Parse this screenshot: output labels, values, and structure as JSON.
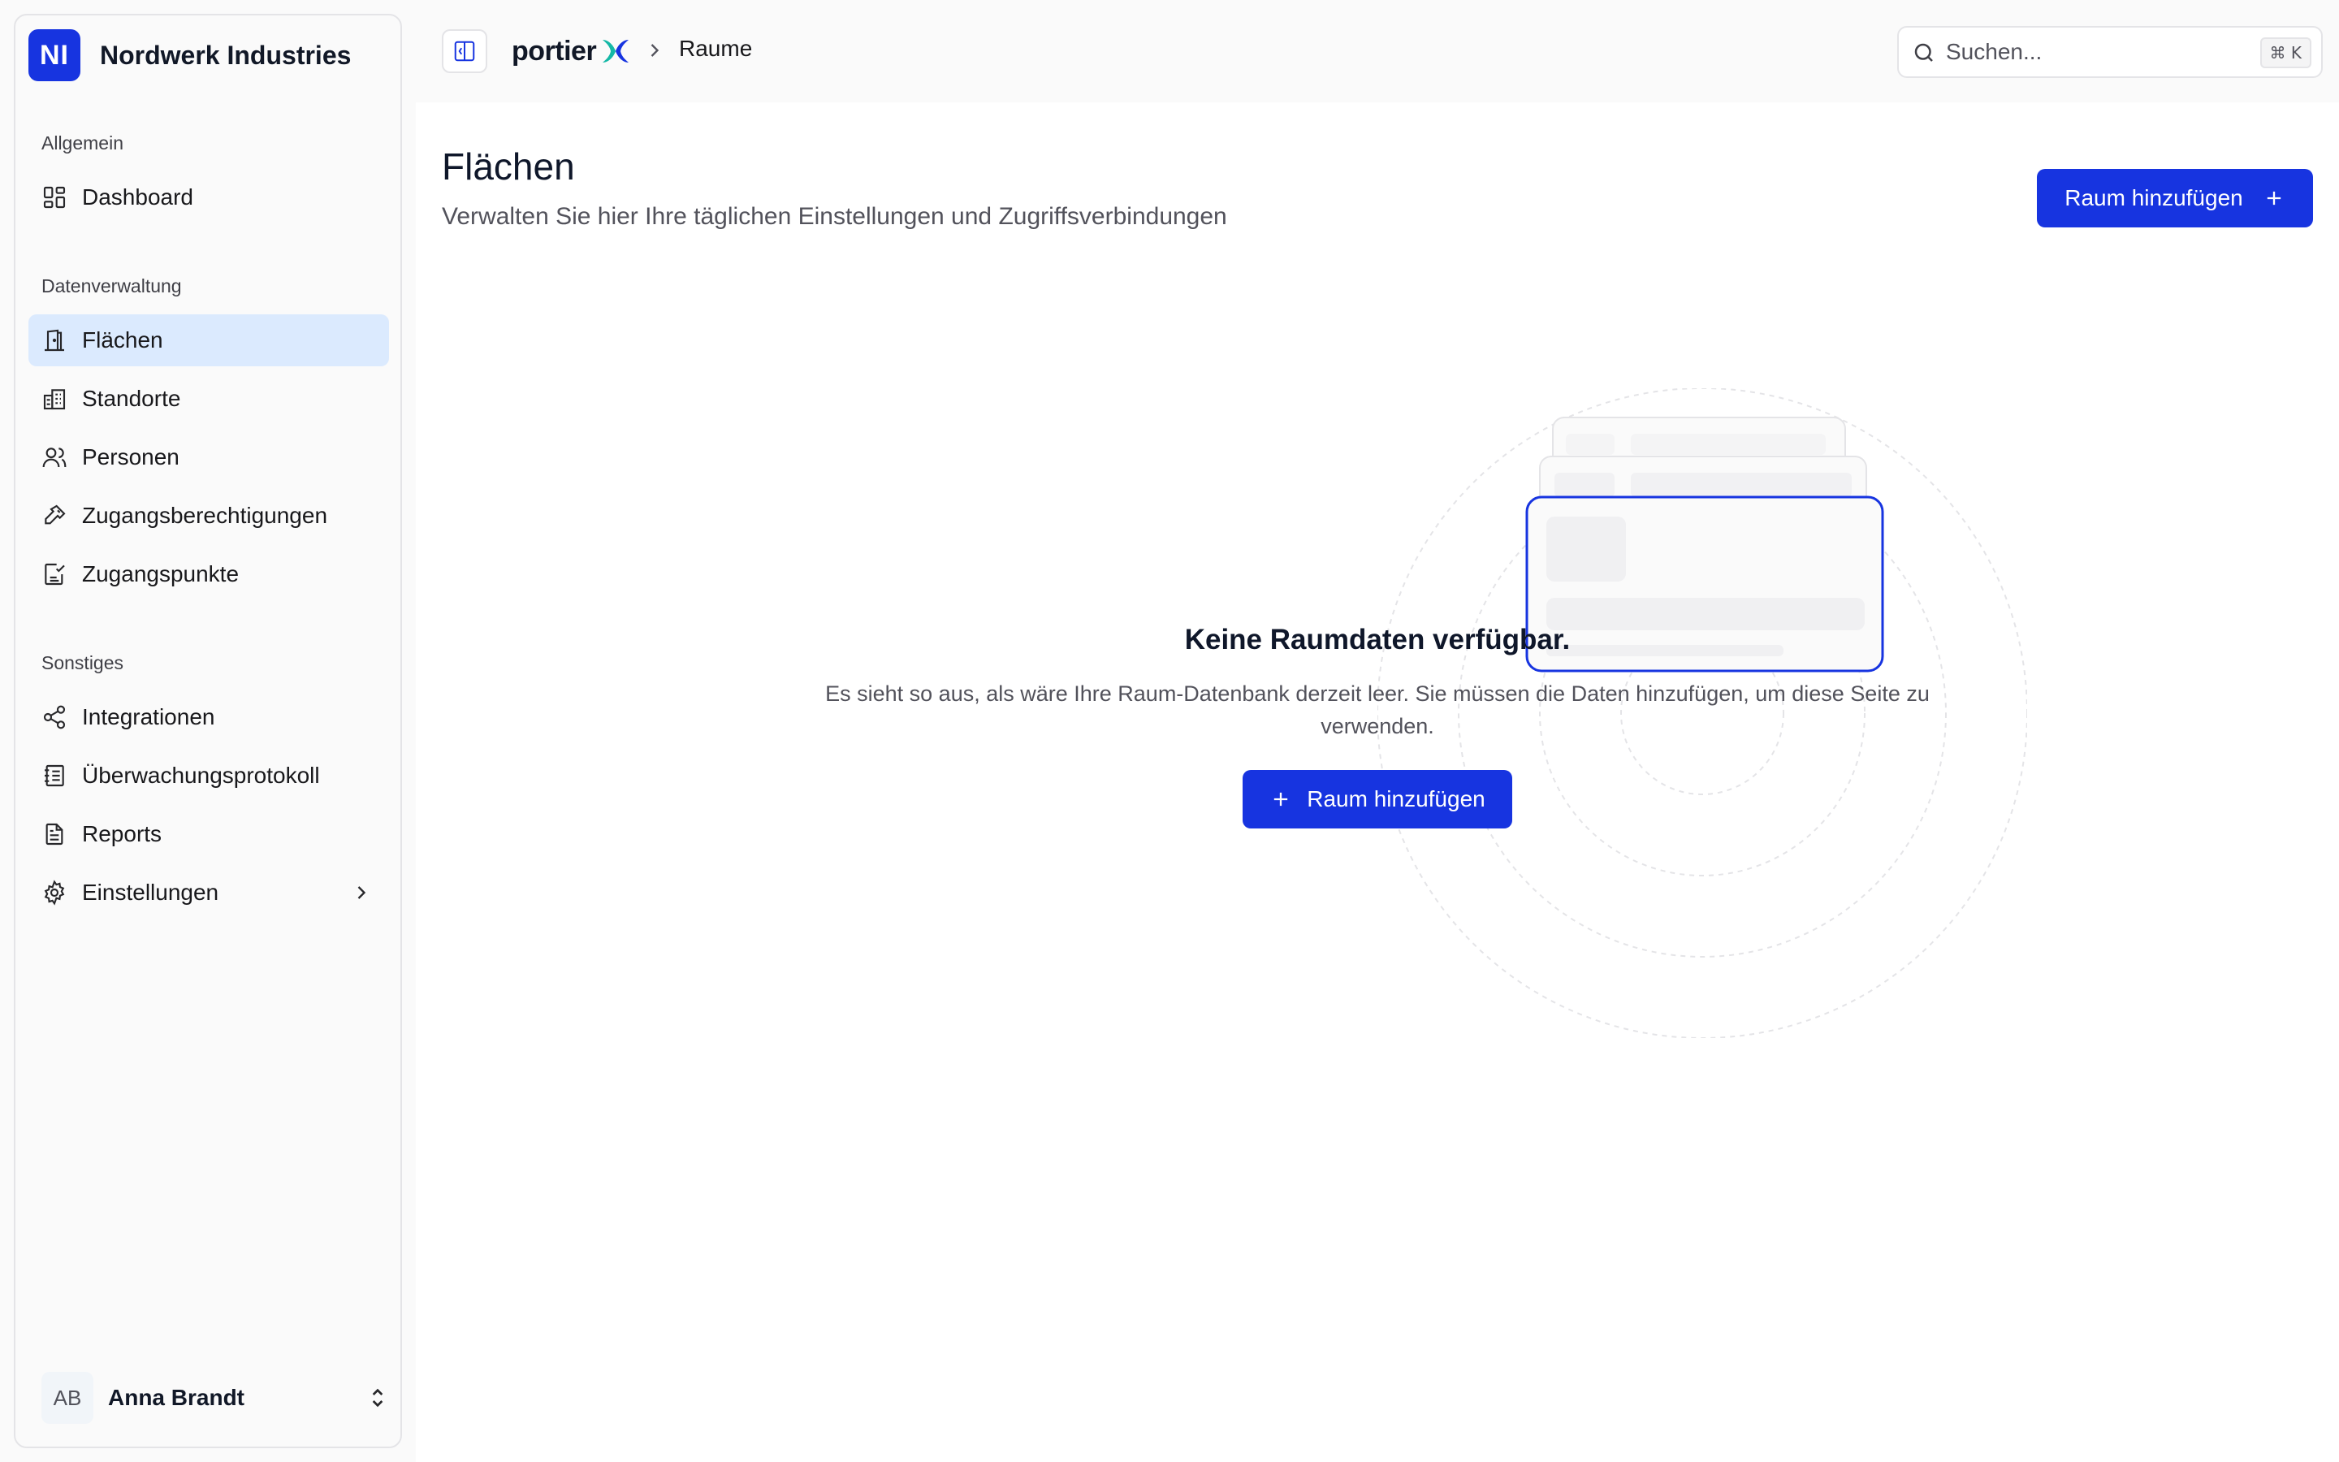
{
  "sidebar": {
    "brand": {
      "initials": "NI",
      "name": "Nordwerk Industries"
    },
    "sections": [
      {
        "label": "Allgemein"
      },
      {
        "label": "Datenverwaltung"
      },
      {
        "label": "Sonstiges"
      }
    ],
    "items": [
      {
        "label": "Dashboard",
        "icon": "dashboard-icon"
      },
      {
        "label": "Flächen",
        "icon": "door-icon",
        "active": true
      },
      {
        "label": "Standorte",
        "icon": "building-icon"
      },
      {
        "label": "Personen",
        "icon": "users-icon"
      },
      {
        "label": "Zugangsberechtigungen",
        "icon": "key-icon"
      },
      {
        "label": "Zugangspunkte",
        "icon": "checklist-icon"
      },
      {
        "label": "Integrationen",
        "icon": "share-icon"
      },
      {
        "label": "Überwachungsprotokoll",
        "icon": "log-icon"
      },
      {
        "label": "Reports",
        "icon": "file-icon"
      },
      {
        "label": "Einstellungen",
        "icon": "gear-icon"
      }
    ],
    "user": {
      "initials": "AB",
      "name": "Anna Brandt"
    }
  },
  "topbar": {
    "logo_text": "portier",
    "breadcrumb": "Raume",
    "search": {
      "placeholder": "Suchen...",
      "shortcut": "⌘ K"
    }
  },
  "main": {
    "title": "Flächen",
    "subtitle": "Verwalten Sie hier Ihre täglichen Einstellungen und Zugriffsverbindungen",
    "add_button": "Raum hinzufügen",
    "empty": {
      "title": "Keine Raumdaten verfügbar.",
      "text": "Es sieht so aus, als wäre Ihre Raum-Datenbank derzeit leer. Sie müssen die Daten hinzufügen, um diese Seite zu verwenden.",
      "button": "Raum hinzufügen"
    }
  },
  "colors": {
    "accent": "#1734e0",
    "active_bg": "#dbeafe",
    "logo_teal": "#14b8a6"
  }
}
